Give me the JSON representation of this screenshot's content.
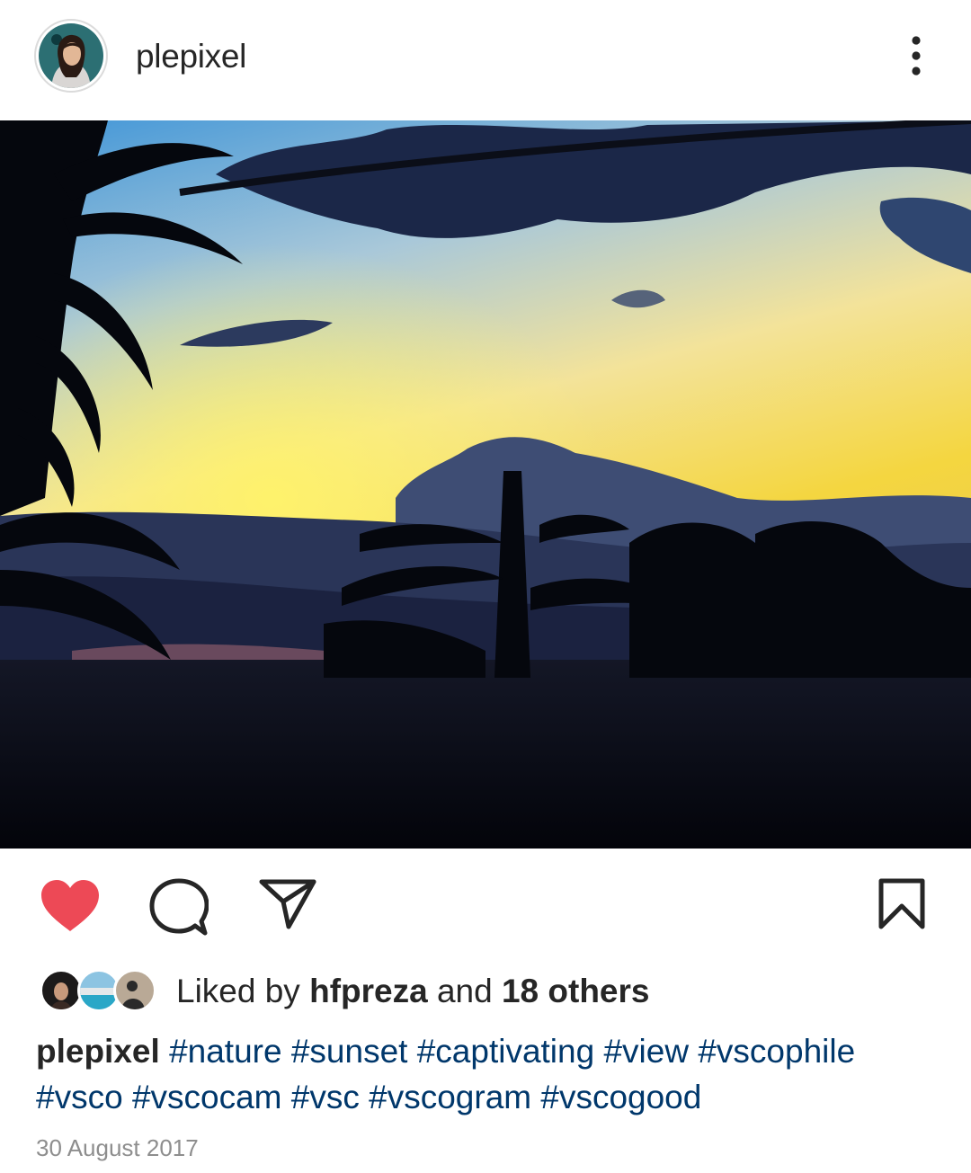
{
  "header": {
    "username": "plepixel",
    "avatar_icon": "profile-avatar",
    "more_icon": "more-vertical-icon"
  },
  "photo": {
    "subject": "sunset-silhouette-photo"
  },
  "actions": {
    "like_icon": "heart-filled-icon",
    "comment_icon": "comment-icon",
    "share_icon": "send-icon",
    "save_icon": "bookmark-icon",
    "like_color": "#ed4956"
  },
  "likes": {
    "prefix": "Liked by ",
    "user": "hfpreza",
    "middle": " and ",
    "others": "18 others"
  },
  "caption": {
    "username": "plepixel",
    "tags": [
      "#nature",
      "#sunset",
      "#captivating",
      "#view",
      "#vscophile",
      "#vsco",
      "#vscocam",
      "#vsc",
      "#vscogram",
      "#vscogood"
    ]
  },
  "date": "30 August 2017",
  "colors": {
    "hashtag": "#00376b",
    "meta": "#8e8e8e",
    "text": "#262626"
  }
}
